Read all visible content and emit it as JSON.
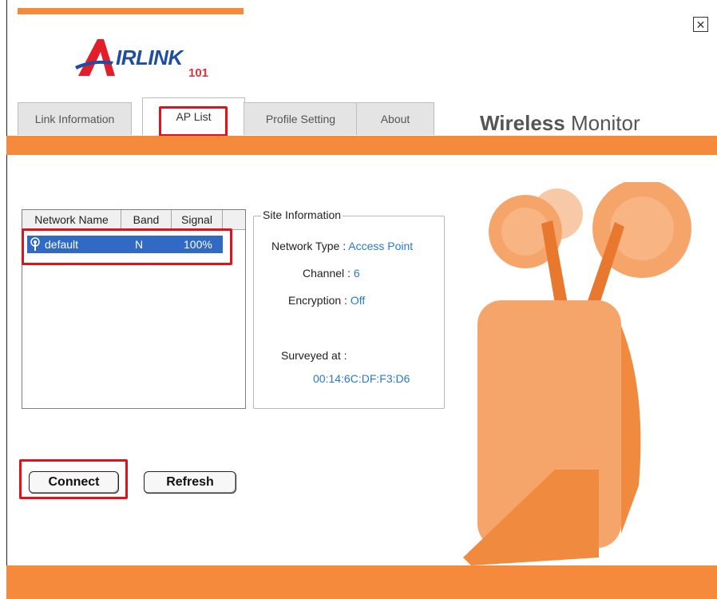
{
  "window": {
    "close_symbol": "✕"
  },
  "logo": {
    "word": "IRLINK",
    "number": "101",
    "colors": {
      "wordmark": "#1f4da3",
      "number": "#e33040"
    }
  },
  "app_title": {
    "bold": "Wireless",
    "light": "Monitor"
  },
  "tabs": [
    {
      "label": "Link Information",
      "active": false
    },
    {
      "label": "AP List",
      "active": true
    },
    {
      "label": "Profile Setting",
      "active": false
    },
    {
      "label": "About",
      "active": false
    }
  ],
  "ap_list": {
    "columns": [
      "Network Name",
      "Band",
      "Signal"
    ],
    "rows": [
      {
        "name": "default",
        "band": "N",
        "signal": "100%",
        "icon": "antenna-icon",
        "selected": true
      }
    ]
  },
  "site_info": {
    "legend": "Site Information",
    "network_type_label": "Network Type :",
    "network_type_value": "Access Point",
    "channel_label": "Channel :",
    "channel_value": "6",
    "encryption_label": "Encryption :",
    "encryption_value": "Off",
    "surveyed_label": "Surveyed at :",
    "surveyed_value": "00:14:6C:DF:F3:D6"
  },
  "buttons": {
    "connect": "Connect",
    "refresh": "Refresh"
  },
  "colors": {
    "accent_orange": "#f58a3c",
    "selection_blue": "#316ac5",
    "value_blue": "#2a79c9",
    "highlight_red": "#e0131a"
  }
}
